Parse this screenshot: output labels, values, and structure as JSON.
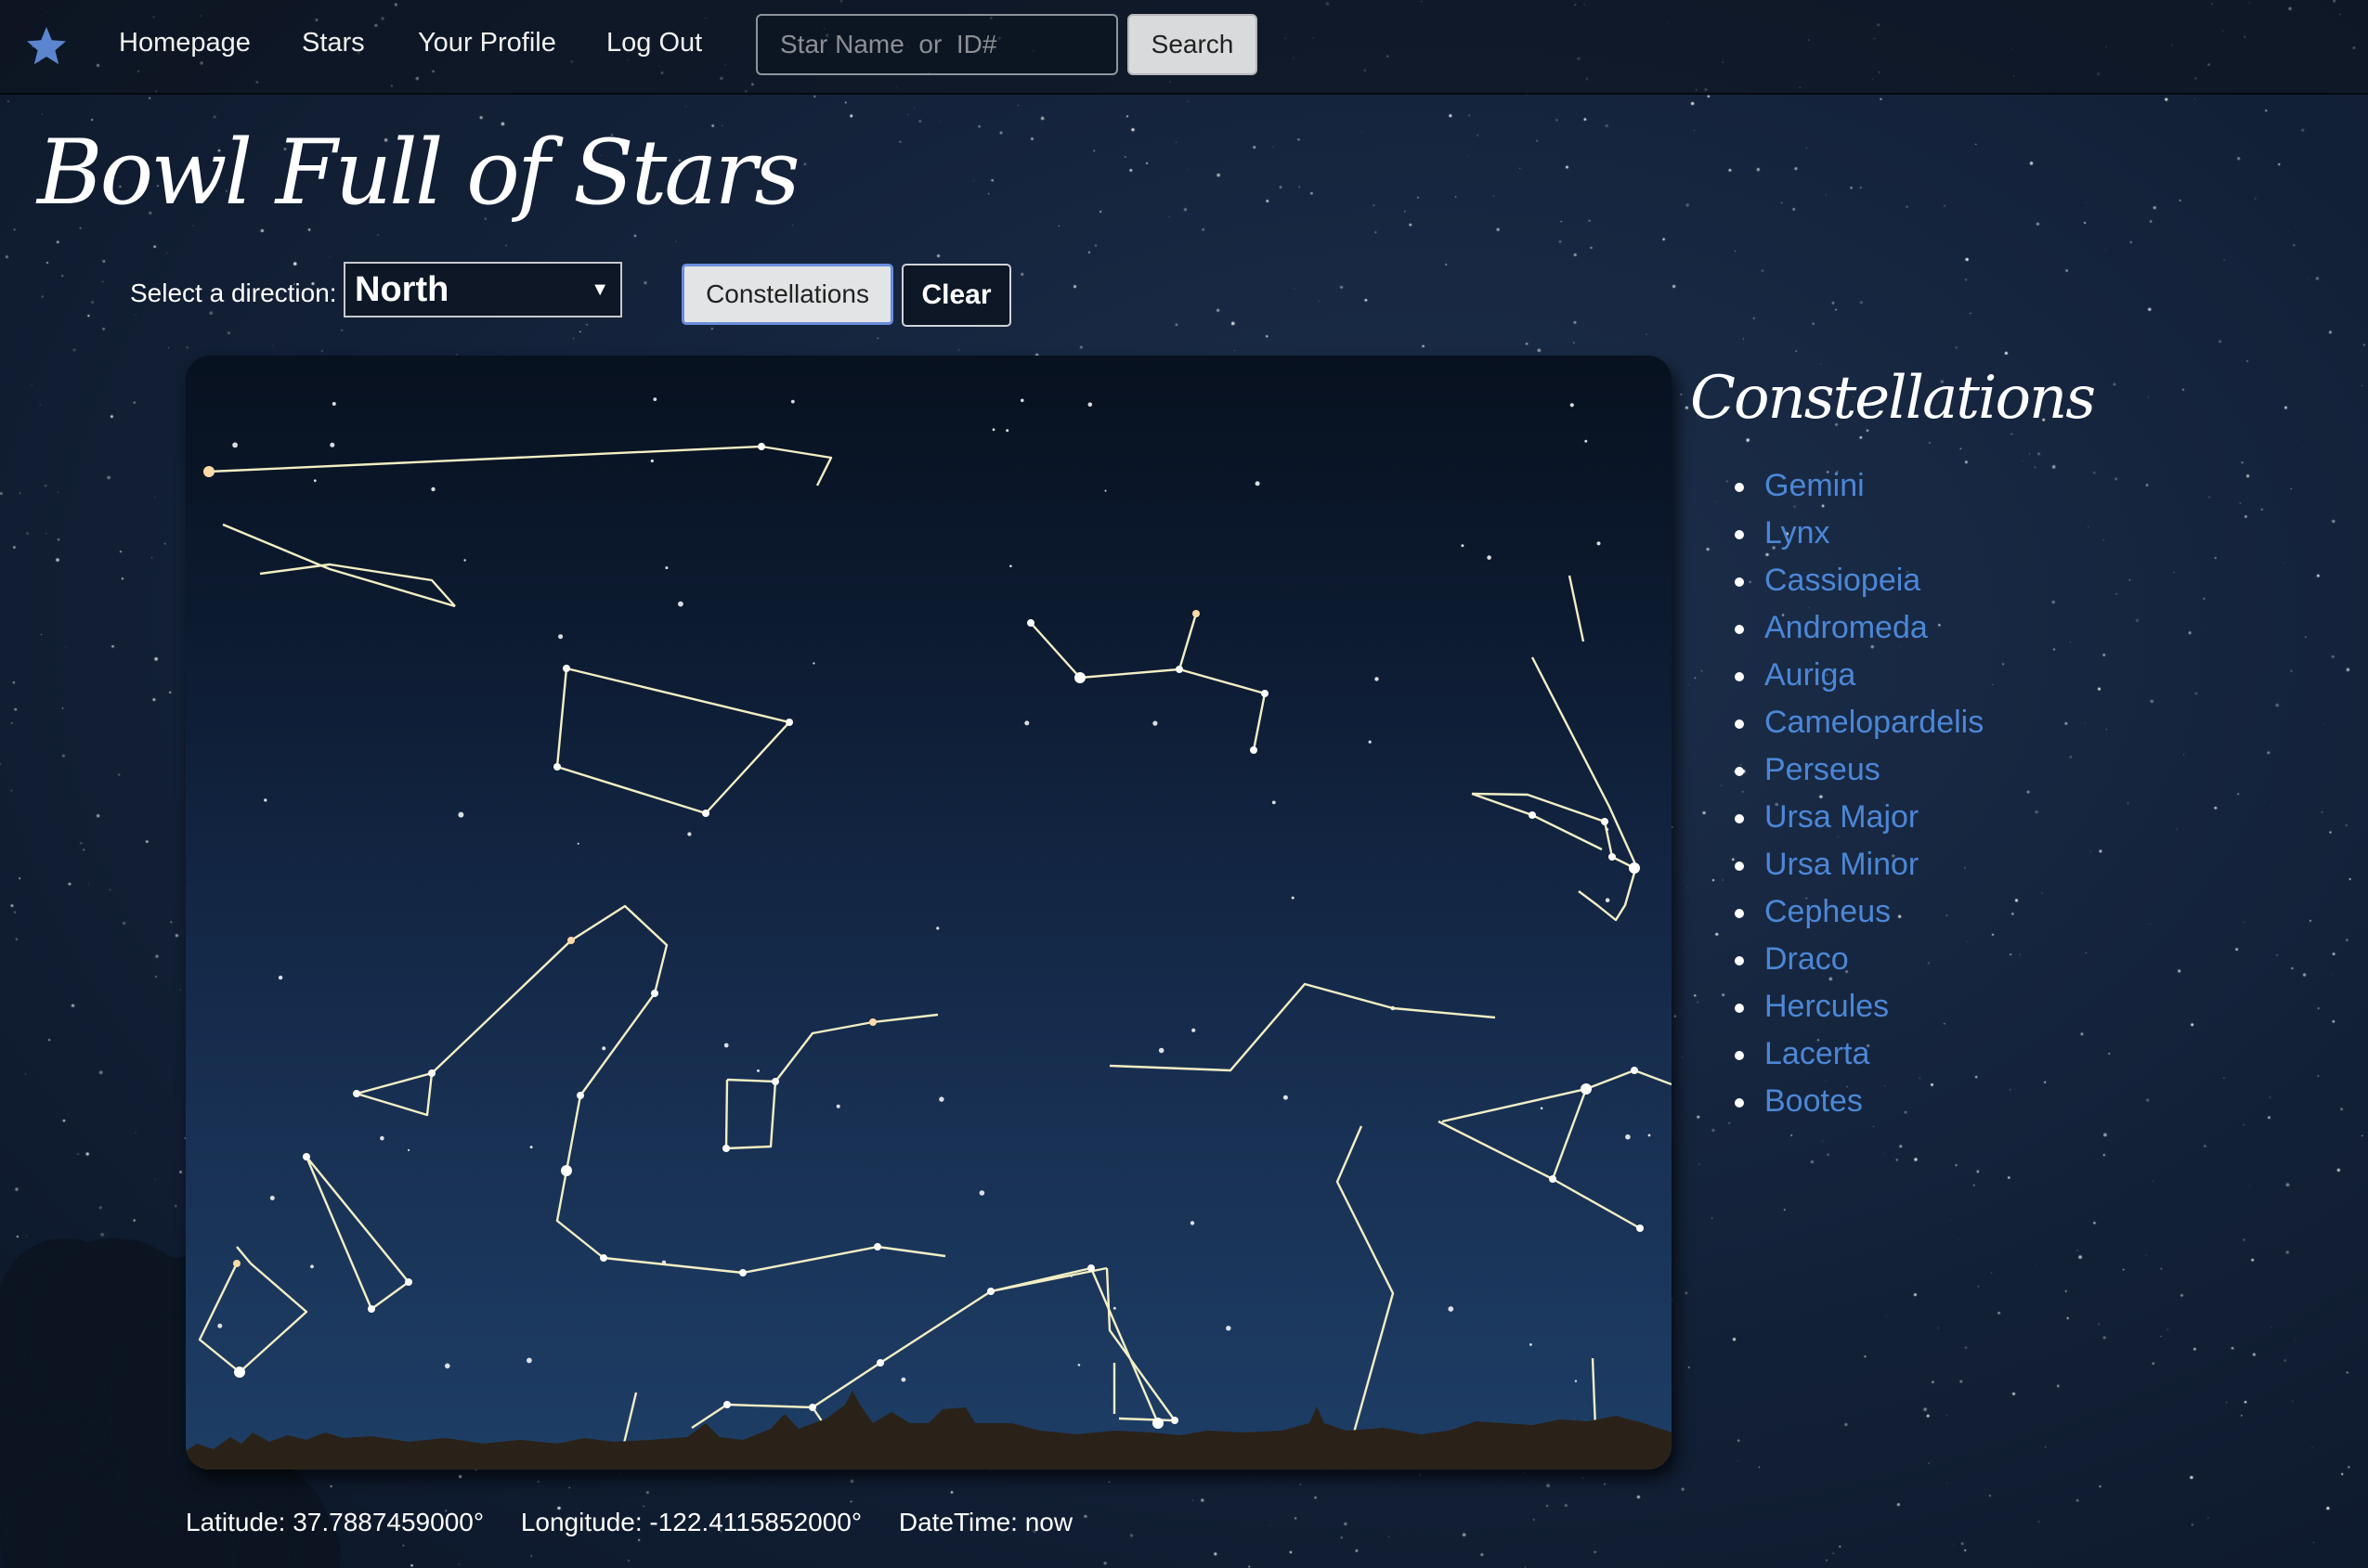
{
  "nav": {
    "brand_icon": "star-icon",
    "links": [
      "Homepage",
      "Stars",
      "Your Profile",
      "Log Out"
    ],
    "search_placeholder": "Star Name  or  ID#",
    "search_label": "Search"
  },
  "title": "Bowl Full of Stars",
  "controls": {
    "direction_label": "Select a direction:",
    "direction_value": "North",
    "constellations_label": "Constellations",
    "clear_label": "Clear"
  },
  "sidebar": {
    "heading": "Constellations",
    "items": [
      "Gemini",
      "Lynx",
      "Cassiopeia",
      "Andromeda",
      "Auriga",
      "Camelopardelis",
      "Perseus",
      "Ursa Major",
      "Ursa Minor",
      "Cepheus",
      "Draco",
      "Hercules",
      "Lacerta",
      "Bootes"
    ]
  },
  "footer": {
    "latitude": "Latitude: 37.7887459000°",
    "longitude": "Longitude: -122.4115852000°",
    "datetime": "DateTime: now"
  },
  "colors": {
    "accent_link": "#4c87d6",
    "constellation_line": "#f3efc4"
  }
}
